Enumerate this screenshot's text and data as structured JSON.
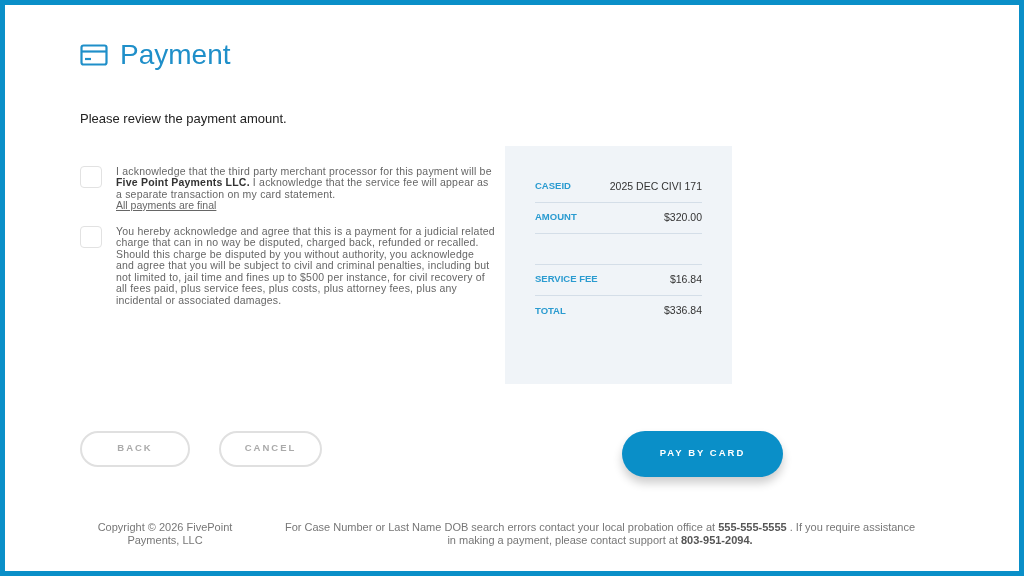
{
  "header": {
    "title": "Payment"
  },
  "intro": "Please review the payment amount.",
  "agreements": [
    {
      "checked": false,
      "text": "I acknowledge that the third party merchant processor for this payment will be **Five Point Payments LLC.** I acknowledge that the service fee will appear as a separate transaction on my card statement.",
      "link": "All payments are final"
    },
    {
      "checked": false,
      "text": "You hereby acknowledge and agree that this is a payment for a judicial related charge that can in no way be disputed, charged back, refunded or recalled. Should this charge be disputed by you without authority, you acknowledge and agree that you will be subject to civil and criminal penalties, including but not limited to, jail time and fines up to $500 per instance, for civil recovery of all fees paid, plus service fees, plus costs, plus attorney fees, plus any incidental or associated damages."
    }
  ],
  "summary": [
    {
      "kind": "line",
      "label": "CASEID",
      "value": "2025 DEC CIVI 171"
    },
    {
      "kind": "line",
      "label": "AMOUNT",
      "value": "$320.00"
    },
    {
      "kind": "empty"
    },
    {
      "kind": "line",
      "label": "SERVICE FEE",
      "value": "$16.84"
    },
    {
      "kind": "line",
      "label": "TOTAL",
      "value": "$336.84"
    }
  ],
  "buttons": {
    "back": "BACK",
    "cancel": "CANCEL",
    "pay": "PAY BY CARD"
  },
  "footer": {
    "copyright": "Copyright © 2026 FivePoint Payments, LLC",
    "notice": "For Case Number or Last Name DOB search errors contact your local probation office at **555-555-5555** . If you require assistance in making a payment, please contact support at **803-951-2094.**"
  }
}
